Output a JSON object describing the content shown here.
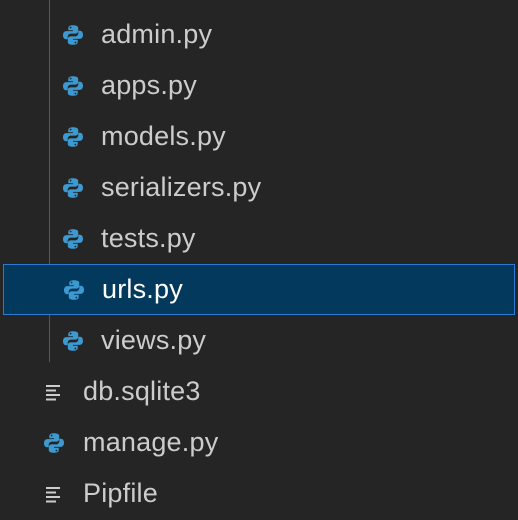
{
  "explorer": {
    "colors": {
      "background": "#252526",
      "text": "#cccccc",
      "selection_bg": "#04395e",
      "selection_border": "#2a7bd3",
      "python_icon": "#3d9ad1"
    },
    "children": [
      {
        "label": "admin.py",
        "icon": "python-icon"
      },
      {
        "label": "apps.py",
        "icon": "python-icon"
      },
      {
        "label": "models.py",
        "icon": "python-icon"
      },
      {
        "label": "serializers.py",
        "icon": "python-icon"
      },
      {
        "label": "tests.py",
        "icon": "python-icon"
      },
      {
        "label": "urls.py",
        "icon": "python-icon",
        "selected": true
      },
      {
        "label": "views.py",
        "icon": "python-icon"
      }
    ],
    "root_files": [
      {
        "label": "db.sqlite3",
        "icon": "text-file-icon"
      },
      {
        "label": "manage.py",
        "icon": "python-icon"
      },
      {
        "label": "Pipfile",
        "icon": "text-file-icon"
      }
    ]
  }
}
